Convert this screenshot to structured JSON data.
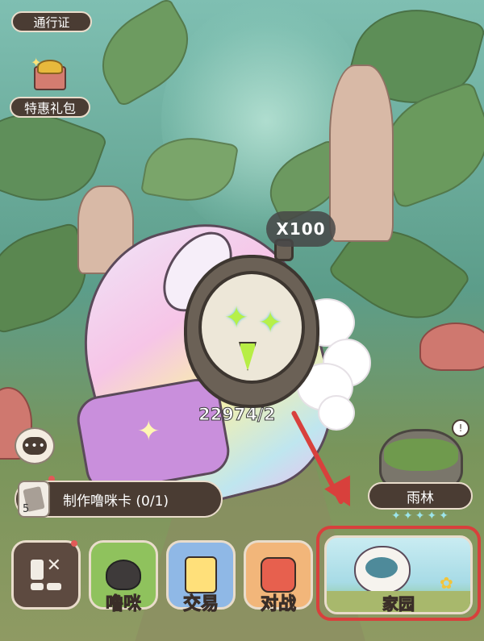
{
  "top_left": {
    "pass_label": "通行证",
    "gift_label": "特惠礼包"
  },
  "character": {
    "multiplier": "X100",
    "progress": "22974/2"
  },
  "side": {
    "chat_glyph": "•••",
    "task_label": "制作噜咪卡 (0/1)",
    "task_count": "5"
  },
  "map": {
    "name": "雨林",
    "stars": "✦✦✦✦✦",
    "clock_glyph": "!"
  },
  "nav": {
    "items": [
      {
        "label": ""
      },
      {
        "label": "噜咪"
      },
      {
        "label": "交易"
      },
      {
        "label": "对战"
      }
    ],
    "home_label": "家园"
  },
  "colors": {
    "highlight": "#d8403c",
    "panel": "#4a3c33"
  }
}
